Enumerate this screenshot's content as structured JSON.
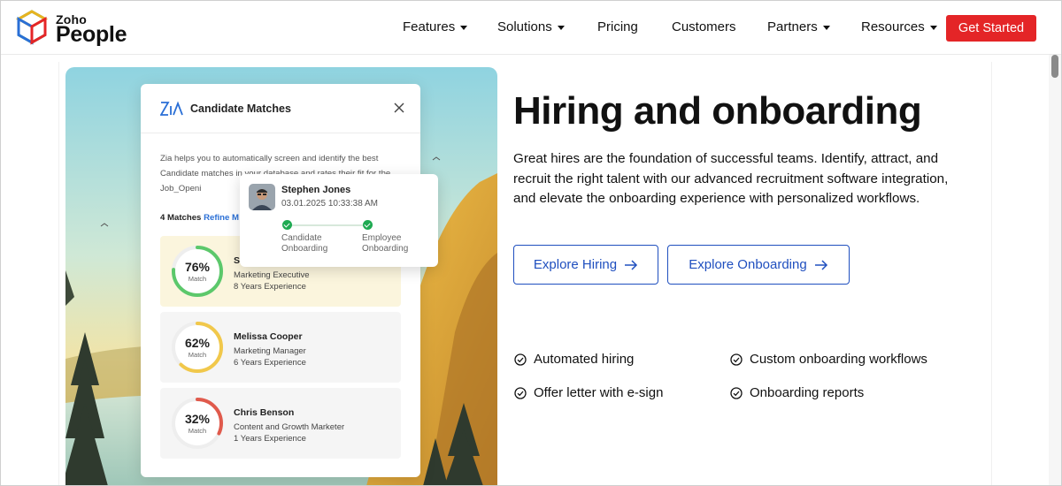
{
  "brand": {
    "line1": "Zoho",
    "line2": "People"
  },
  "nav": {
    "items": [
      {
        "label": "Features",
        "dropdown": true
      },
      {
        "label": "Solutions",
        "dropdown": true
      },
      {
        "label": "Pricing",
        "dropdown": false
      },
      {
        "label": "Customers",
        "dropdown": false
      },
      {
        "label": "Partners",
        "dropdown": true
      },
      {
        "label": "Resources",
        "dropdown": true
      }
    ],
    "cta": "Get Started"
  },
  "card": {
    "title": "Candidate Matches",
    "description": "Zia helps you to automatically screen and identify the best Candidate matches in your database and rates their fit for the Job_Openi",
    "matches_count": "4 Matches",
    "refine": "Refine M",
    "candidates": [
      {
        "pct": "76%",
        "sub": "Match",
        "name": "S",
        "role": "Marketing Executive",
        "experience": "8 Years Experience"
      },
      {
        "pct": "62%",
        "sub": "Match",
        "name": "Melissa Cooper",
        "role": "Marketing Manager",
        "experience": "6 Years Experience"
      },
      {
        "pct": "32%",
        "sub": "Match",
        "name": "Chris Benson",
        "role": "Content and Growth Marketer",
        "experience": "1 Years Experience"
      }
    ],
    "match_levels": [
      0.76,
      0.62,
      0.32
    ]
  },
  "popup": {
    "name": "Stephen Jones",
    "datetime": "03.01.2025  10:33:38 AM",
    "step1": "Candidate\nOnboarding",
    "step2": "Employee\nOnboarding"
  },
  "hero": {
    "title": "Hiring and onboarding",
    "description": "Great hires are the foundation of successful teams. Identify, attract, and recruit the right talent with our advanced recruitment software integration, and elevate the onboarding experience with personalized workflows.",
    "btn_hiring": "Explore Hiring",
    "btn_onboarding": "Explore Onboarding",
    "features": [
      "Automated hiring",
      "Custom onboarding workflows",
      "Offer letter with e-sign",
      "Onboarding reports"
    ]
  },
  "colors": {
    "accent_red": "#e42527",
    "accent_blue": "#1f4fbf",
    "ring_green": "#5cc86b",
    "ring_yellow": "#f1c84b",
    "ring_red": "#e05a4c"
  }
}
